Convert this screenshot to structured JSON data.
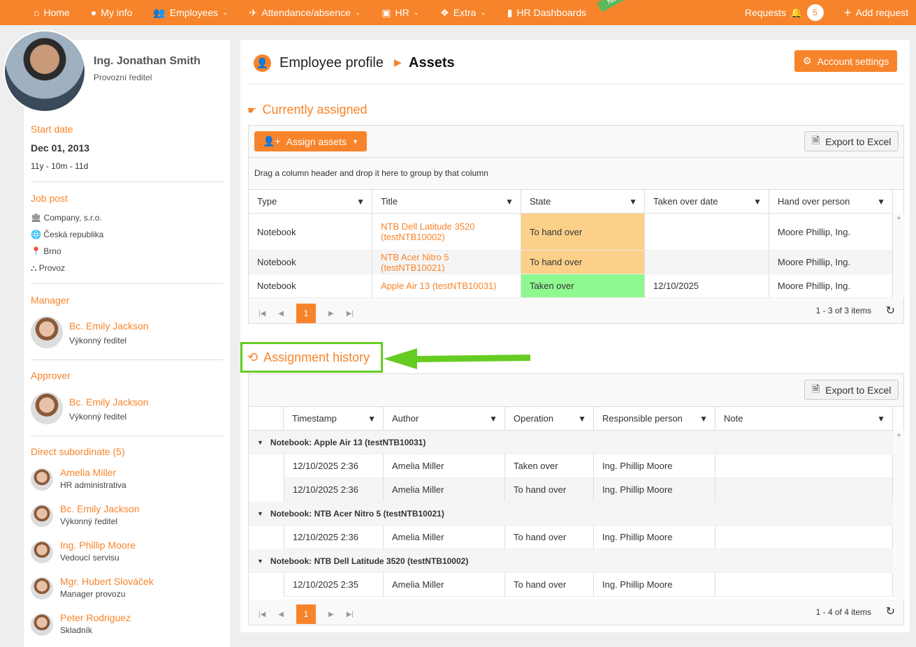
{
  "nav": {
    "items": [
      {
        "icon": "home-icon",
        "label": "Home"
      },
      {
        "icon": "user-circle-icon",
        "label": "My info"
      },
      {
        "icon": "users-icon",
        "label": "Employees"
      },
      {
        "icon": "plane-icon",
        "label": "Attendance/absence"
      },
      {
        "icon": "hr-icon",
        "label": "HR"
      },
      {
        "icon": "cubes-icon",
        "label": "Extra"
      },
      {
        "icon": "bar-chart-icon",
        "label": "HR Dashboards"
      }
    ],
    "new_badge": "New",
    "requests": "Requests",
    "requests_count": "5",
    "add_request": "Add request",
    "accent": "#f7842a"
  },
  "profile": {
    "name": "Ing. Jonathan Smith",
    "role": "Provozní ředitel",
    "start_label": "Start date",
    "start_date": "Dec 01, 2013",
    "tenure": "11y - 10m - 11d",
    "job_label": "Job post",
    "company": "Company, s.r.o.",
    "country": "Česká republika",
    "city": "Brno",
    "department": "Provoz",
    "manager_label": "Manager",
    "manager": {
      "name": "Bc. Emily Jackson",
      "role": "Výkonný ředitel"
    },
    "approver_label": "Approver",
    "approver": {
      "name": "Bc. Emily Jackson",
      "role": "Výkonný ředitel"
    },
    "subordinates_label": "Direct subordinate (5)",
    "subordinates": [
      {
        "name": "Amelia Miller",
        "role": "HR administrativa"
      },
      {
        "name": "Bc. Emily Jackson",
        "role": "Výkonný ředitel"
      },
      {
        "name": "Ing. Phillip Moore",
        "role": "Vedoucí servisu"
      },
      {
        "name": "Mgr. Hubert Slováček",
        "role": "Manager provozu"
      },
      {
        "name": "Peter Rodriguez",
        "role": "Skladník"
      }
    ]
  },
  "header": {
    "breadcrumb_parent": "Employee profile",
    "breadcrumb_current": "Assets",
    "account_settings": "Account settings"
  },
  "current": {
    "title": "Currently assigned",
    "assign_button": "Assign assets",
    "export": "Export to Excel",
    "group_hint": "Drag a column header and drop it here to group by that column",
    "columns": [
      "Type",
      "Title",
      "State",
      "Taken over date",
      "Hand over person"
    ],
    "rows": [
      [
        "Notebook",
        "NTB Dell Latitude 3520 (testNTB10002)",
        "To hand over",
        "",
        "Moore Phillip, Ing."
      ],
      [
        "Notebook",
        "NTB Acer Nitro 5 (testNTB10021)",
        "To hand over",
        "",
        "Moore Phillip, Ing."
      ],
      [
        "Notebook",
        "Apple Air 13 (testNTB10031)",
        "Taken over",
        "12/10/2025",
        "Moore Phillip, Ing."
      ]
    ],
    "state_colors": {
      "To hand over": "#fdd08a",
      "Taken over": "#90f890"
    },
    "page": "1",
    "summary": "1 - 3 of 3 items"
  },
  "history": {
    "title": "Assignment history",
    "export": "Export to Excel",
    "columns": [
      "Timestamp",
      "Author",
      "Operation",
      "Responsible person",
      "Note"
    ],
    "groups": [
      {
        "label": "Notebook: Apple Air 13 (testNTB10031)",
        "rows": [
          [
            "12/10/2025 2:36",
            "Amelia Miller",
            "Taken over",
            "Ing. Phillip Moore",
            ""
          ],
          [
            "12/10/2025 2:36",
            "Amelia Miller",
            "To hand over",
            "Ing. Phillip Moore",
            ""
          ]
        ]
      },
      {
        "label": "Notebook: NTB Acer Nitro 5 (testNTB10021)",
        "rows": [
          [
            "12/10/2025 2:36",
            "Amelia Miller",
            "To hand over",
            "Ing. Phillip Moore",
            ""
          ]
        ]
      },
      {
        "label": "Notebook: NTB Dell Latitude 3520 (testNTB10002)",
        "rows": [
          [
            "12/10/2025 2:35",
            "Amelia Miller",
            "To hand over",
            "Ing. Phillip Moore",
            ""
          ]
        ]
      }
    ],
    "page": "1",
    "summary": "1 - 4 of 4 items",
    "highlight_color": "#66cc22"
  }
}
